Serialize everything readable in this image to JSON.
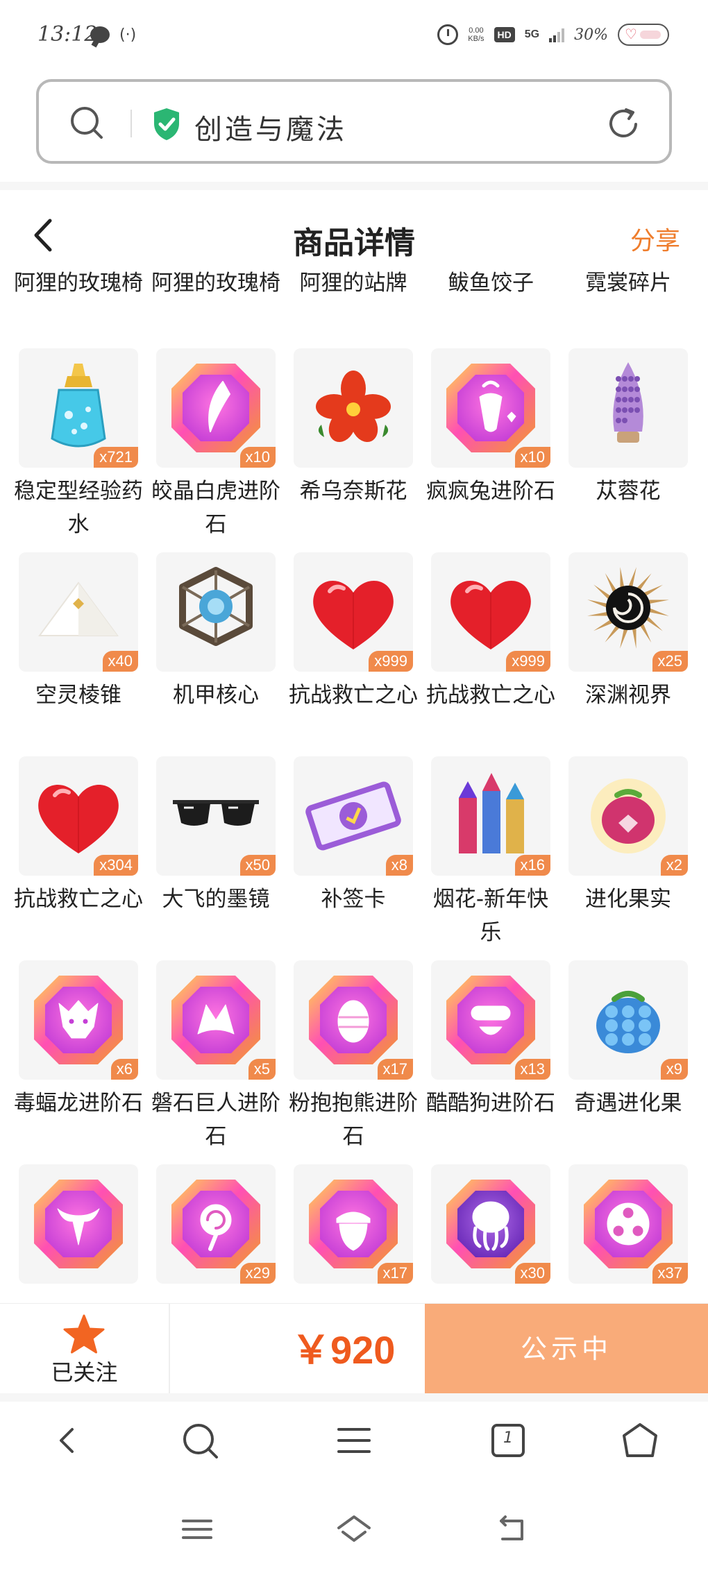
{
  "status_bar": {
    "time": "13:12",
    "net_speed_value": "0.00",
    "net_speed_unit": "KB/s",
    "hd": "HD",
    "network": "5G",
    "battery": "30%"
  },
  "address_bar": {
    "site_title": "创造与魔法",
    "icons": [
      "search-icon",
      "shield-check-icon",
      "reload-icon"
    ],
    "shield_color": "#2bb673"
  },
  "page_header": {
    "title": "商品详情",
    "share": "分享",
    "accent_color": "#ef7d2c"
  },
  "items": [
    {
      "name": "阿狸的玫瑰椅",
      "qty": "",
      "art": "none"
    },
    {
      "name": "阿狸的玫瑰椅",
      "qty": "",
      "art": "none"
    },
    {
      "name": "阿狸的站牌",
      "qty": "",
      "art": "none"
    },
    {
      "name": "鲅鱼饺子",
      "qty": "",
      "art": "none"
    },
    {
      "name": "霓裳碎片",
      "qty": "",
      "art": "none"
    },
    {
      "name": "稳定型经验药水",
      "qty": "x721",
      "art": "potion"
    },
    {
      "name": "皎晶白虎进阶石",
      "qty": "x10",
      "art": "gem-claw"
    },
    {
      "name": "希乌奈斯花",
      "qty": "",
      "art": "red-flower"
    },
    {
      "name": "疯疯兔进阶石",
      "qty": "x10",
      "art": "gem-rabbit"
    },
    {
      "name": "苁蓉花",
      "qty": "",
      "art": "purple-flower"
    },
    {
      "name": "空灵棱锥",
      "qty": "x40",
      "art": "pyramid"
    },
    {
      "name": "机甲核心",
      "qty": "",
      "art": "mech-core"
    },
    {
      "name": "抗战救亡之心",
      "qty": "x999",
      "art": "heart"
    },
    {
      "name": "抗战救亡之心",
      "qty": "x999",
      "art": "heart"
    },
    {
      "name": "深渊视界",
      "qty": "x25",
      "art": "abyss"
    },
    {
      "name": "抗战救亡之心",
      "qty": "x304",
      "art": "heart"
    },
    {
      "name": "大飞的墨镜",
      "qty": "x50",
      "art": "sunglasses"
    },
    {
      "name": "补签卡",
      "qty": "x8",
      "art": "ticket"
    },
    {
      "name": "烟花-新年快乐",
      "qty": "x16",
      "art": "fireworks"
    },
    {
      "name": "进化果实",
      "qty": "x2",
      "art": "berry"
    },
    {
      "name": "毒蝠龙进阶石",
      "qty": "x6",
      "art": "gem-dragon"
    },
    {
      "name": "磐石巨人进阶石",
      "qty": "x5",
      "art": "gem-giant"
    },
    {
      "name": "粉抱抱熊进阶石",
      "qty": "x17",
      "art": "gem-egg"
    },
    {
      "name": "酷酷狗进阶石",
      "qty": "x13",
      "art": "gem-dog"
    },
    {
      "name": "奇遇进化果",
      "qty": "x9",
      "art": "blue-berry"
    },
    {
      "name": "",
      "qty": "",
      "art": "gem-bull"
    },
    {
      "name": "",
      "qty": "x29",
      "art": "gem-lollipop"
    },
    {
      "name": "",
      "qty": "x17",
      "art": "gem-acorn"
    },
    {
      "name": "",
      "qty": "x30",
      "art": "gem-octopus"
    },
    {
      "name": "",
      "qty": "x37",
      "art": "gem-flower"
    }
  ],
  "action_bar": {
    "follow_label": "已关注",
    "price": "￥920",
    "status_button": "公示中",
    "price_color": "#ef5a1e",
    "button_color": "#f9ab79"
  },
  "browser_toolbar": {
    "icons": [
      "back-icon",
      "search-icon",
      "menu-icon",
      "tabs-icon",
      "home-icon"
    ],
    "tab_count": "1"
  },
  "system_nav": {
    "icons": [
      "menu-icon",
      "home-icon",
      "back-icon"
    ]
  }
}
